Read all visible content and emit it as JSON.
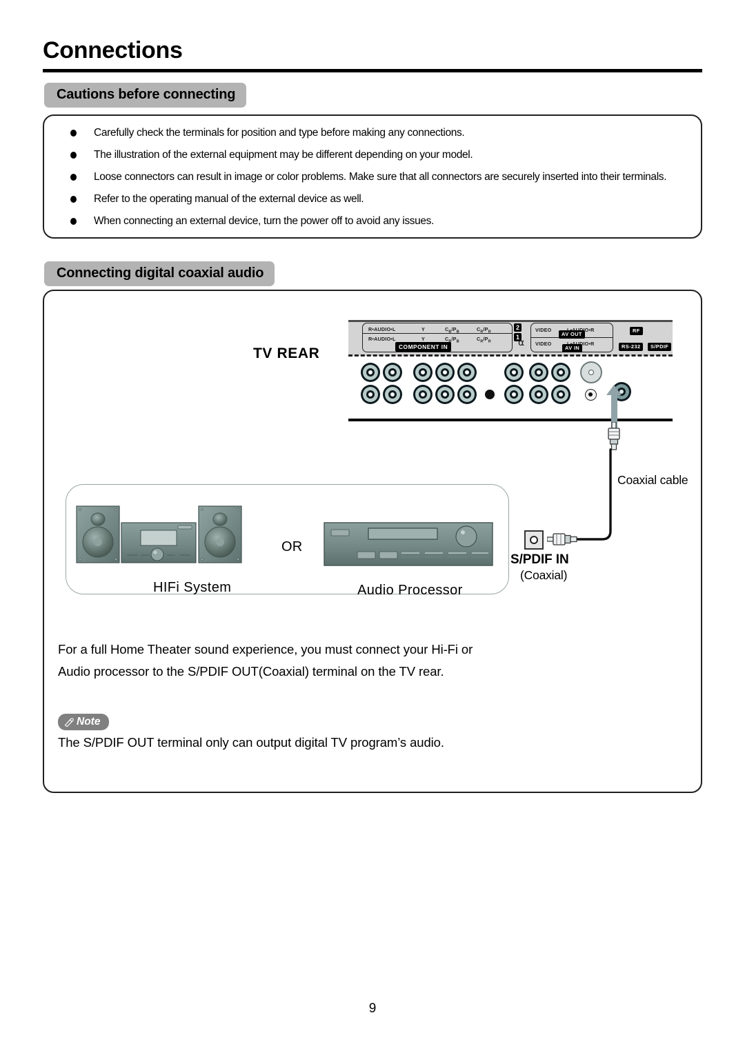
{
  "page": {
    "title": "Connections",
    "number": "9"
  },
  "sections": {
    "cautions": {
      "heading": "Cautions before connecting",
      "bullets": [
        "Carefully check the terminals for position and type before making any connections.",
        "The illustration of the external equipment may be different depending on your model.",
        "Loose connectors can result in image or color problems. Make sure that all connectors are securely inserted into their terminals.",
        "Refer to the operating manual of the external device as well.",
        "When connecting an external device, turn the power off to avoid any issues."
      ]
    },
    "coaxial": {
      "heading": "Connecting digital coaxial audio",
      "body": "For a full Home Theater sound experience, you must connect your Hi-Fi or Audio processor to the S/PDIF OUT(Coaxial) terminal on the TV rear.",
      "note_label": "Note",
      "note_text": "The S/PDIF OUT terminal only can output digital TV program’s audio."
    }
  },
  "diagram": {
    "tv_rear_label": "TV REAR",
    "panel": {
      "component_in": {
        "group_label": "COMPONENT IN",
        "row2_number": "2",
        "row1_number": "1",
        "audio_label": "R•AUDIO•L",
        "y_label": "Y",
        "cb_label": "C",
        "cb_sub": "B",
        "pb_label": "/P",
        "pb_sub": "B",
        "cr_label": "C",
        "cr_sub": "R",
        "pr_label": "/P",
        "pr_sub": "R"
      },
      "av": {
        "video_label": "VIDEO",
        "audio_label": "L•AUDIO•R",
        "out_tag": "AV OUT",
        "in_tag": "AV IN"
      },
      "rf_tag": "RF",
      "rs232_tag": "RS-232",
      "spdif_tag": "S/PDIF"
    },
    "cable_label": "Coaxial cable",
    "spdif_in_label": "S/PDIF IN",
    "spdif_in_sub": "(Coaxial)",
    "or_label": "OR",
    "hifi_caption": "HIFi  System",
    "processor_caption": "Audio  Processor"
  },
  "colors": {
    "pill_gray": "#b3b3b3",
    "note_gray": "#808080",
    "panel_plate": "#d4d4d4",
    "device_body": "#6e8280",
    "arrow": "#8fa3a8"
  }
}
